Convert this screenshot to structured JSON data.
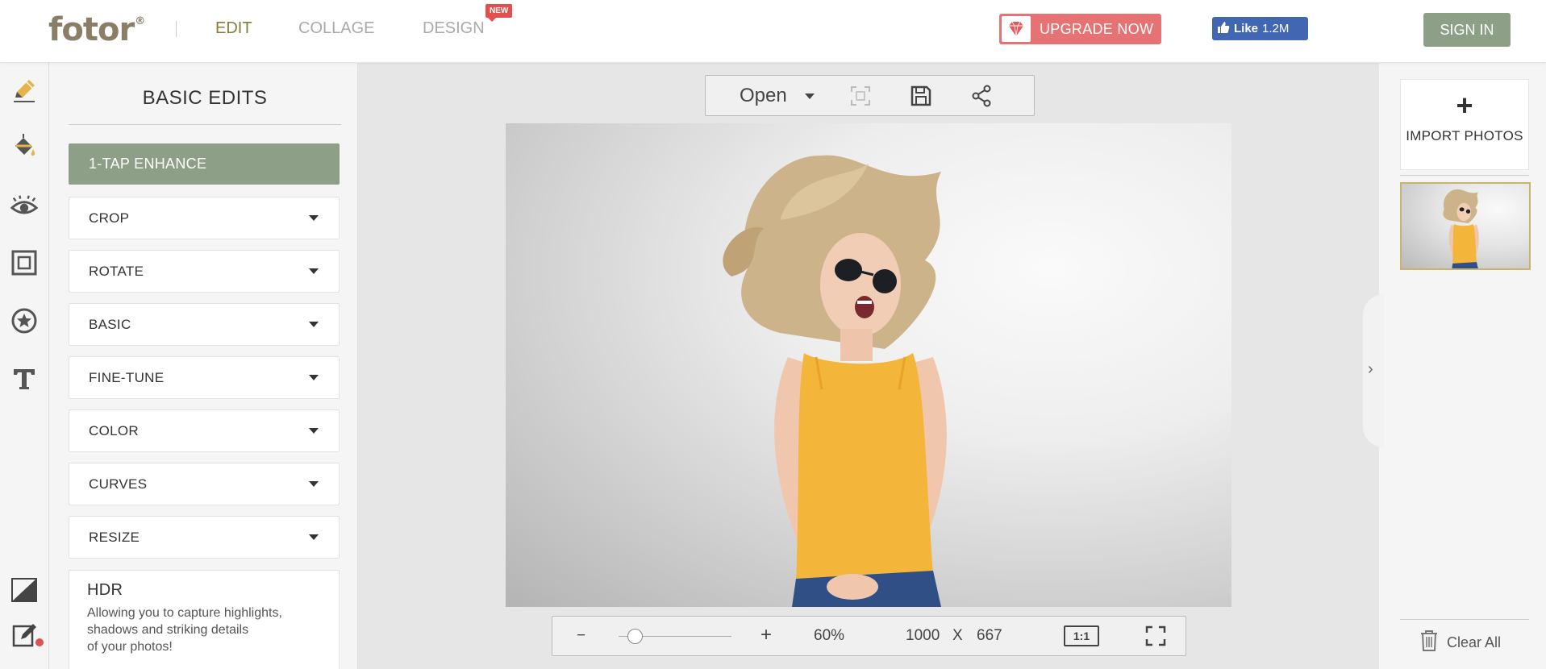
{
  "header": {
    "logo": "fotor",
    "logo_mark": "®",
    "nav": {
      "edit": "EDIT",
      "collage": "COLLAGE",
      "design": "DESIGN"
    },
    "new_badge": "NEW",
    "upgrade_label": "UPGRADE NOW",
    "fb_like_label": "Like",
    "fb_like_count": "1.2M",
    "signin_label": "SIGN IN",
    "accent_color": "#8e9f87",
    "upgrade_color": "#e67273"
  },
  "rail": {
    "icons": [
      "pencil-icon",
      "paint-bucket-icon",
      "eye-icon",
      "frame-icon",
      "sticker-star-icon",
      "text-icon",
      "tilt-shift-icon",
      "edit-note-icon"
    ]
  },
  "panel": {
    "title": "BASIC EDITS",
    "enhance_label": "1-TAP ENHANCE",
    "sections": [
      "CROP",
      "ROTATE",
      "BASIC",
      "FINE-TUNE",
      "COLOR",
      "CURVES",
      "RESIZE"
    ],
    "hdr": {
      "title": "HDR",
      "description_lines": [
        "Allowing you to capture highlights,",
        "shadows and striking details",
        "of your photos!"
      ]
    }
  },
  "toolbar": {
    "open_label": "Open",
    "icons": [
      "fit-screen-icon",
      "save-icon",
      "share-icon"
    ]
  },
  "zoom": {
    "minus": "−",
    "plus": "+",
    "level": "60%",
    "level_value": 0.15,
    "width": "1000",
    "x": "X",
    "height": "667",
    "actual_size": "1:1"
  },
  "right": {
    "import_plus": "+",
    "import_label": "IMPORT PHOTOS",
    "clear_label": "Clear All",
    "expand_glyph": "›"
  }
}
